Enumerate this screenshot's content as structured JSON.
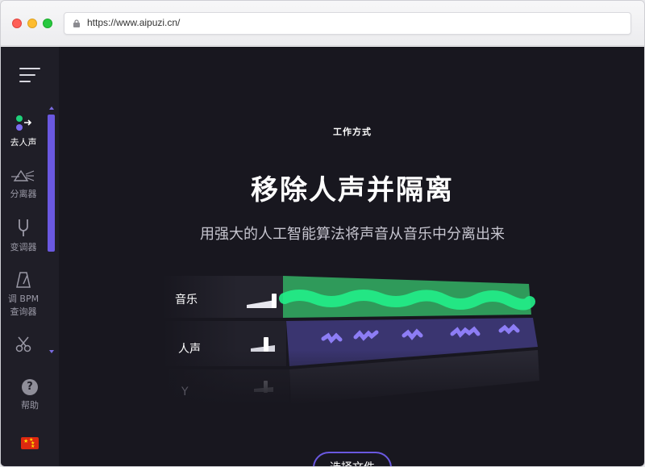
{
  "browser": {
    "url": "https://www.aipuzi.cn/"
  },
  "sidebar": {
    "items": [
      {
        "label": "去人声",
        "icon": "remove-vocals-icon"
      },
      {
        "label": "分离器",
        "icon": "splitter-icon"
      },
      {
        "label": "变调器",
        "icon": "tuning-fork-icon"
      },
      {
        "label": "调 BPM",
        "label2": "查询器",
        "icon": "metronome-icon"
      },
      {
        "label": "",
        "icon": "scissors-icon"
      }
    ],
    "help_label": "帮助",
    "language": "china-flag-icon"
  },
  "main": {
    "eyebrow": "工作方式",
    "headline": "移除人声并隔离",
    "subline": "用强大的人工智能算法将声音从音乐中分离出来",
    "tracks": [
      {
        "label": "音乐",
        "color": "#1fd07a"
      },
      {
        "label": "人声",
        "color": "#7b6bf0"
      },
      {
        "label": "Y",
        "color": "#444450"
      }
    ],
    "cta": "选择文件"
  },
  "colors": {
    "accent": "#6a58e0",
    "bg": "#18171f",
    "sidebar": "#1f1e27"
  }
}
